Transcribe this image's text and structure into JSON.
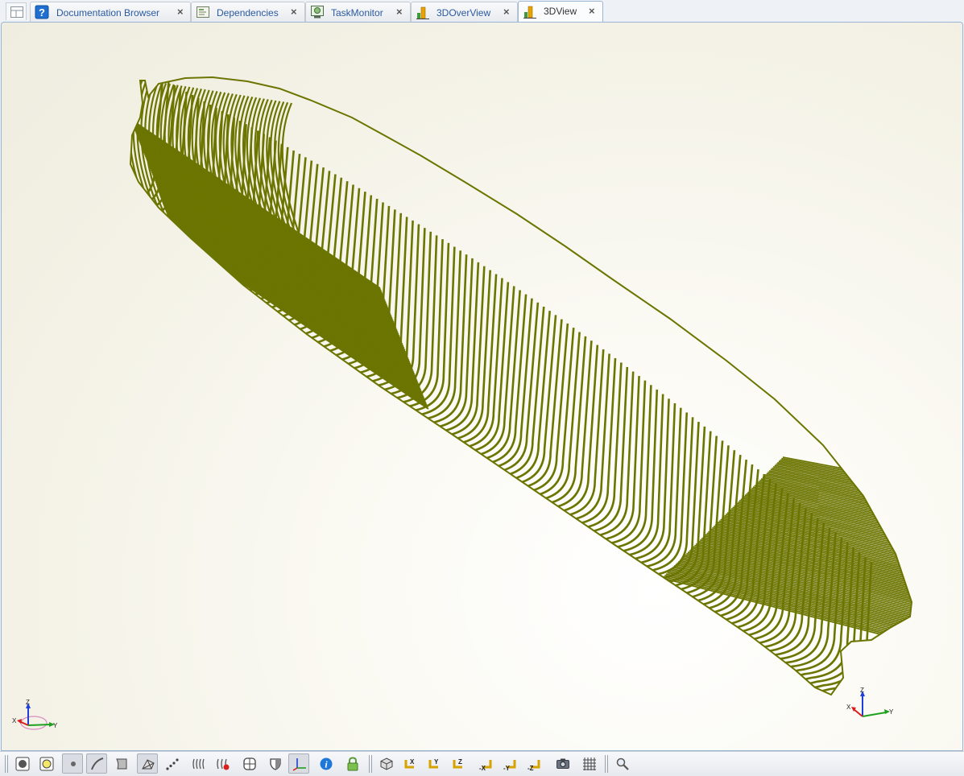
{
  "tabs": [
    {
      "label": "Documentation Browser",
      "icon": "help-icon",
      "active": false
    },
    {
      "label": "Dependencies",
      "icon": "dependencies-icon",
      "active": false
    },
    {
      "label": "TaskMonitor",
      "icon": "task-monitor-icon",
      "active": false
    },
    {
      "label": "3DOverView",
      "icon": "bar-chart-icon",
      "active": false
    },
    {
      "label": "3DView",
      "icon": "bar-chart-icon",
      "active": true
    }
  ],
  "tab_close_glyph": "×",
  "triad": {
    "x_label": "X",
    "y_label": "Y",
    "z_label": "Z"
  },
  "model": {
    "color": "#6b7500",
    "background": "#f2f0e3"
  },
  "toolbar": [
    {
      "name": "render-shaded-button",
      "pressed": false
    },
    {
      "name": "render-highlight-button",
      "pressed": false
    },
    {
      "name": "show-points-button",
      "pressed": true
    },
    {
      "name": "show-curves-button",
      "pressed": true
    },
    {
      "name": "show-surfaces-button",
      "pressed": false
    },
    {
      "name": "show-mesh-button",
      "pressed": true
    },
    {
      "name": "point-cloud-button",
      "pressed": false
    },
    {
      "name": "sections-button",
      "pressed": false
    },
    {
      "name": "hide-sections-button",
      "pressed": false
    },
    {
      "name": "split-view-button",
      "pressed": false
    },
    {
      "name": "half-view-button",
      "pressed": false
    },
    {
      "name": "axis-toggle-button",
      "pressed": true
    },
    {
      "name": "info-button",
      "pressed": false
    },
    {
      "name": "lock-button",
      "pressed": false
    },
    {
      "name": "iso-view-button",
      "pressed": false
    },
    {
      "name": "view-x-button",
      "label": "X",
      "pressed": false
    },
    {
      "name": "view-y-button",
      "label": "Y",
      "pressed": false
    },
    {
      "name": "view-z-button",
      "label": "Z",
      "pressed": false
    },
    {
      "name": "view-minus-x-button",
      "label": "-X",
      "pressed": false
    },
    {
      "name": "view-minus-y-button",
      "label": "-Y",
      "pressed": false
    },
    {
      "name": "view-minus-z-button",
      "label": "-Z",
      "pressed": false
    },
    {
      "name": "screenshot-button",
      "pressed": false
    },
    {
      "name": "grid-button",
      "pressed": false
    },
    {
      "name": "zoom-button",
      "pressed": false
    }
  ]
}
